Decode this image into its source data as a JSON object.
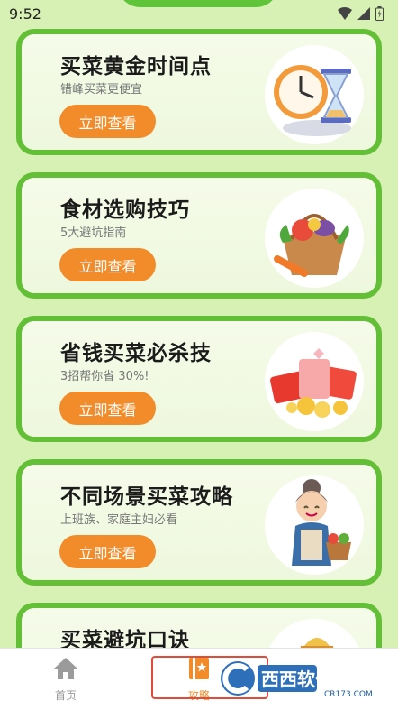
{
  "status_bar": {
    "time": "9:52"
  },
  "cards": [
    {
      "title": "买菜黄金时间点",
      "subtitle": "错峰买菜更便宜",
      "button": "立即查看",
      "art_icon": "hourglass-clock-icon"
    },
    {
      "title": "食材选购技巧",
      "subtitle": "5大避坑指南",
      "button": "立即查看",
      "art_icon": "vegetable-basket-icon"
    },
    {
      "title": "省钱买菜必杀技",
      "subtitle": "3招帮你省 30%!",
      "button": "立即查看",
      "art_icon": "red-envelope-coins-icon"
    },
    {
      "title": "不同场景买菜攻略",
      "subtitle": "上班族、家庭主妇必看",
      "button": "立即查看",
      "art_icon": "grandma-basket-icon"
    },
    {
      "title": "买菜避坑口诀",
      "subtitle": "",
      "button": "",
      "art_icon": "straw-hat-icon"
    }
  ],
  "bottom_nav": {
    "items": [
      {
        "label": "首页",
        "icon": "home-icon"
      },
      {
        "label": "攻略",
        "icon": "bookmark-icon"
      }
    ],
    "active_color": "#f28c2a"
  },
  "watermark": {
    "text": "西西软件园",
    "url_text": "CR173.COM"
  }
}
